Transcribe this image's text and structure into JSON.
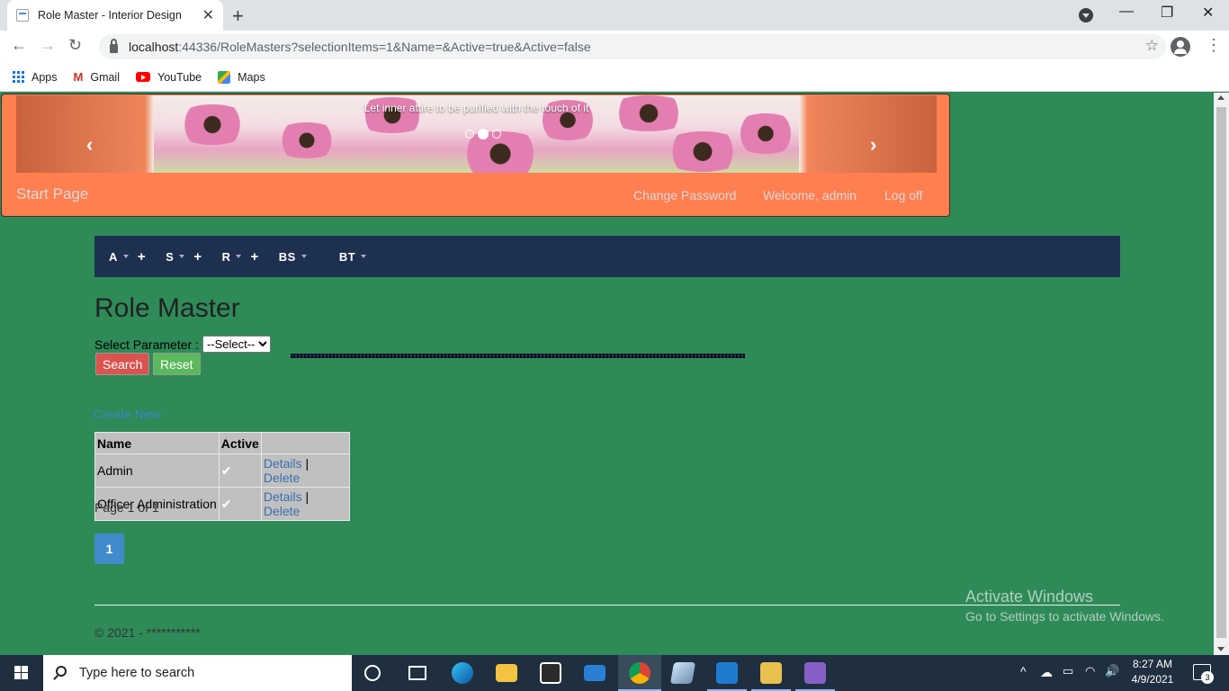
{
  "browser": {
    "tab_title": "Role Master - Interior Design",
    "url_host": "localhost",
    "url_rest": ":44336/RoleMasters?selectionItems=1&Name=&Active=true&Active=false",
    "bookmarks": [
      {
        "label": "Apps",
        "icon": "apps-icon"
      },
      {
        "label": "Gmail",
        "icon": "gmail-icon"
      },
      {
        "label": "YouTube",
        "icon": "youtube-icon"
      },
      {
        "label": "Maps",
        "icon": "maps-icon"
      }
    ]
  },
  "header": {
    "carousel_caption": "Let inner attire to be purified with the touch of it",
    "brand": "Start Page",
    "change_password": "Change Password",
    "welcome": "Welcome, admin",
    "logoff": "Log off",
    "colors": {
      "background": "#ff7f50",
      "text": "#d9d9d9"
    }
  },
  "menu": {
    "items": [
      {
        "label": "A",
        "plus": "+"
      },
      {
        "label": "S",
        "plus": "+"
      },
      {
        "label": "R",
        "plus": "+"
      },
      {
        "label": "BS",
        "plus": ""
      },
      {
        "label": "BT",
        "plus": ""
      }
    ],
    "background": "#1e3050"
  },
  "main": {
    "title": "Role Master",
    "select_label": "Select Parameter :",
    "select_value": "--Select--",
    "search_label": "Search",
    "reset_label": "Reset",
    "create_new": "Create New",
    "table": {
      "headers": [
        "Name",
        "Active",
        ""
      ],
      "rows": [
        {
          "name": "Admin",
          "active": "✔",
          "details": "Details",
          "sep": "|",
          "delete": "Delete"
        },
        {
          "name": "Officer Administration",
          "active": "✔",
          "details": "Details",
          "sep": "|",
          "delete": "Delete"
        }
      ]
    },
    "page_info": "Page 1 of 1",
    "current_page": "1",
    "footer": "© 2021 - ***********"
  },
  "watermark": {
    "line1": "Activate Windows",
    "line2": "Go to Settings to activate Windows."
  },
  "taskbar": {
    "search_placeholder": "Type here to search",
    "time": "8:27 AM",
    "date": "4/9/2021",
    "notification_count": "3"
  },
  "page_background": "#2e8b57"
}
